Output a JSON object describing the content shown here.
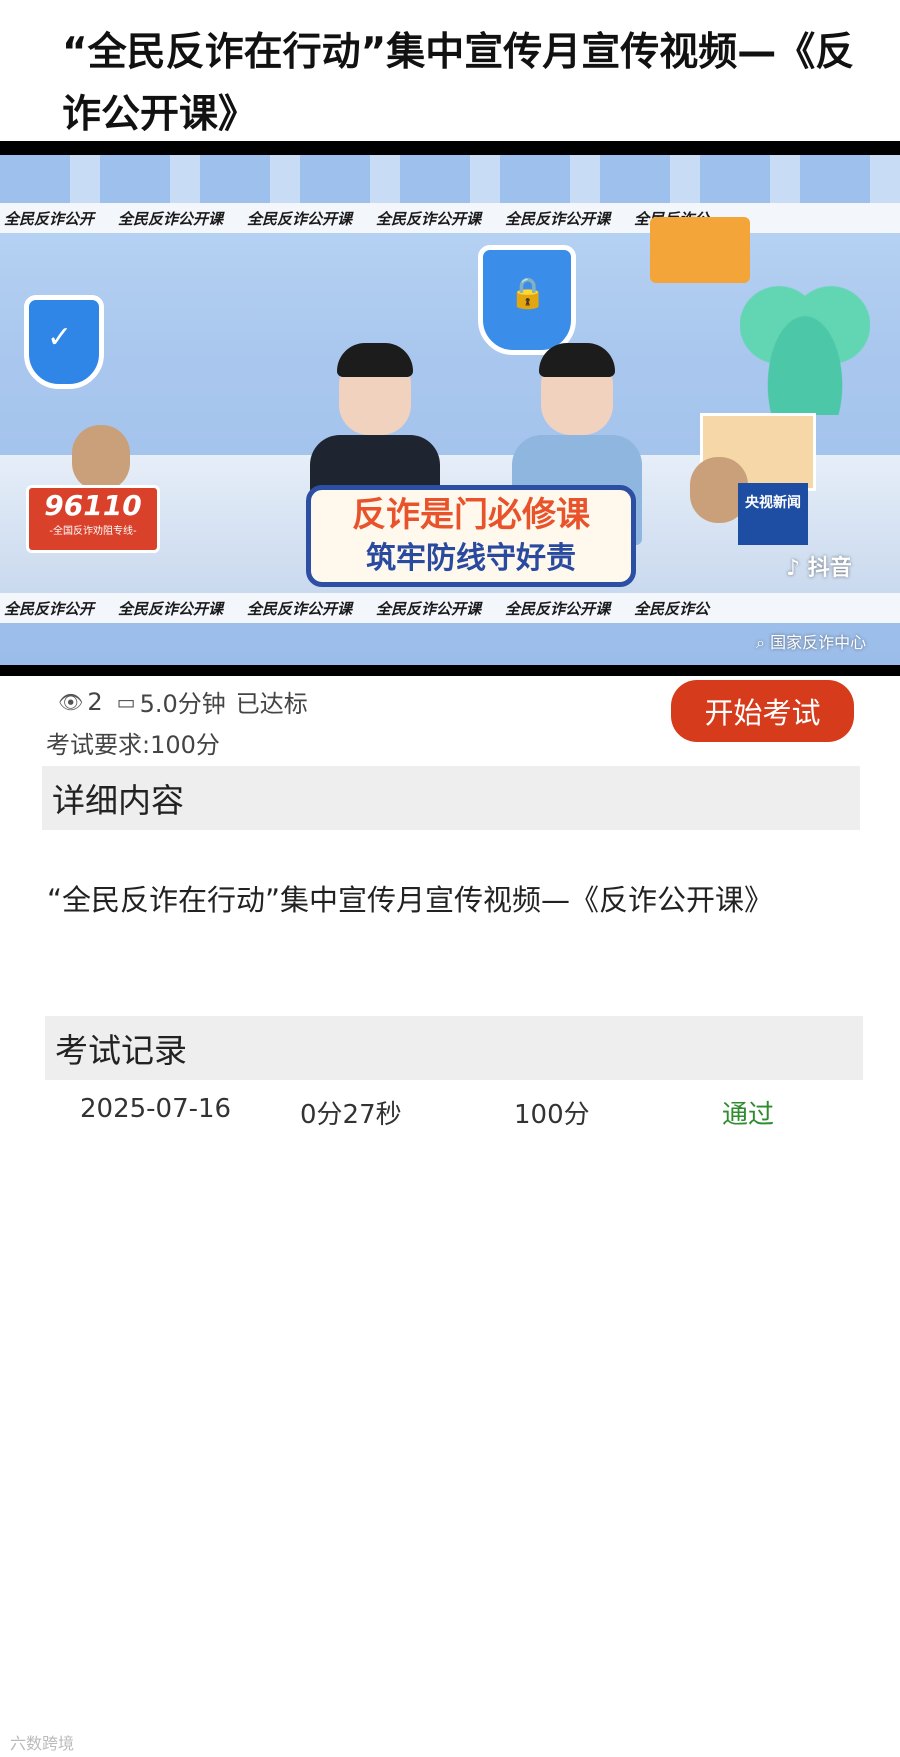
{
  "header": {
    "title": "“全民反诈在行动”集中宣传月宣传视频—《反诈公开课》"
  },
  "video": {
    "ticker_items": [
      "全民反诈公开",
      "全民反诈公开课",
      "全民反诈公开课",
      "全民反诈公开课",
      "全民反诈公开课",
      "全民反诈公"
    ],
    "ticker_items_bottom": [
      "全民反诈公开",
      "全民反诈公开课",
      "全民反诈公开课",
      "全民反诈公开课",
      "全民反诈公开课",
      "全民反诈公"
    ],
    "hotline_number": "96110",
    "hotline_sub": "-全国反诈劝阻专线-",
    "slogan_line1": "反诈是门必修课",
    "slogan_line2": "筑牢防线守好责",
    "cctv_label": "央视新闻",
    "douyin_label": "抖音",
    "search_tag": "国家反诈中心"
  },
  "meta": {
    "views": "2",
    "duration": "5.0分钟",
    "status": "已达标",
    "exam_requirement": "考试要求:100分"
  },
  "buttons": {
    "start_exam": "开始考试"
  },
  "detail": {
    "section_title": "详细内容",
    "description": "“全民反诈在行动”集中宣传月宣传视频—《反诈公开课》"
  },
  "records": {
    "section_title": "考试记录",
    "rows": [
      {
        "date": "2025-07-16",
        "time_spent": "0分27秒",
        "score": "100分",
        "result": "通过"
      }
    ]
  },
  "watermark": "六数跨境",
  "colors": {
    "primary_button": "#d63b1c",
    "pass_status": "#2e8b2e",
    "section_bg": "#eeeeee"
  }
}
